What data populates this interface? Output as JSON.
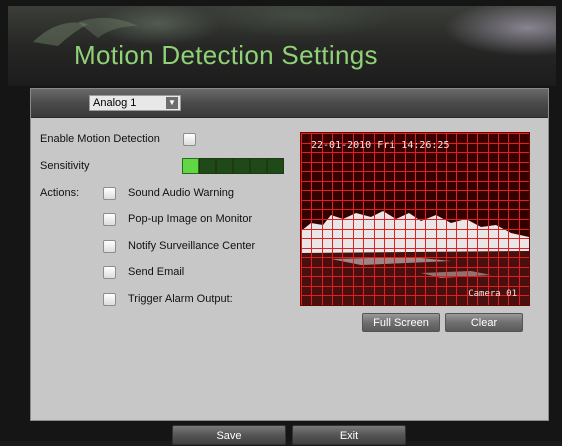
{
  "header": {
    "title": "Motion Detection Settings"
  },
  "camera_select": {
    "value": "Analog 1"
  },
  "enable": {
    "label": "Enable Motion Detection"
  },
  "sensitivity": {
    "label": "Sensitivity",
    "level": 1,
    "max": 6
  },
  "actions": {
    "label": "Actions:",
    "items": [
      {
        "label": "Sound Audio Warning"
      },
      {
        "label": "Pop-up Image on Monitor"
      },
      {
        "label": "Notify Surveillance Center"
      },
      {
        "label": "Send Email"
      },
      {
        "label": "Trigger Alarm Output:"
      }
    ]
  },
  "preview": {
    "timestamp": "22-01-2010 Fri 14:26:25",
    "camera_label": "Camera 01"
  },
  "buttons": {
    "full_screen": "Full Screen",
    "clear": "Clear",
    "save": "Save",
    "exit": "Exit"
  },
  "colors": {
    "title": "#8fd176",
    "sensitivity_on": "#5fd843",
    "sensitivity_off": "#1f4a17",
    "grid": "#e02020"
  }
}
